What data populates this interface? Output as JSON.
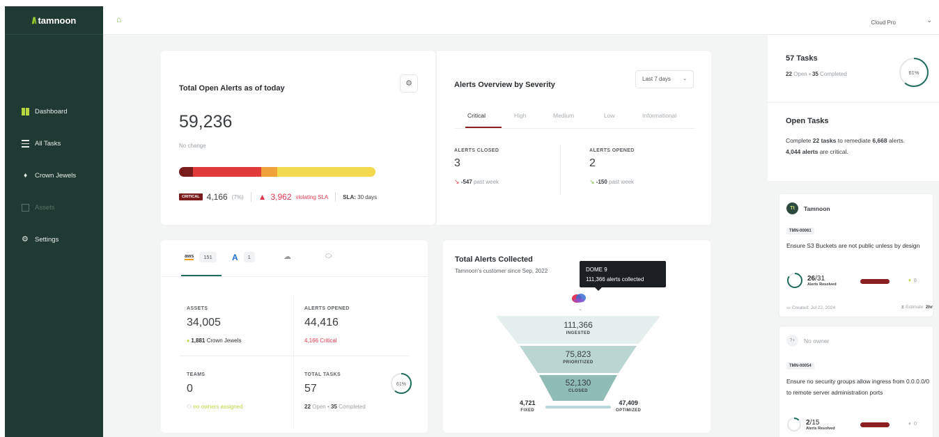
{
  "app": {
    "brand": "tamnoon",
    "account": "Cloud Pro"
  },
  "sidebar": {
    "items": [
      {
        "label": "Dashboard",
        "icon": "dashboard-icon"
      },
      {
        "label": "All Tasks",
        "icon": "list-icon"
      },
      {
        "label": "Crown Jewels",
        "icon": "gem-icon"
      },
      {
        "label": "Assets",
        "icon": "assets-icon",
        "disabled": true
      },
      {
        "label": "Settings",
        "icon": "gear-icon"
      }
    ]
  },
  "open_alerts": {
    "title": "Total Open Alerts as of today",
    "total": "59,236",
    "change": "No change",
    "severity_shares": {
      "critical": 7,
      "high": 35,
      "medium": 8,
      "low": 50
    },
    "critical_badge": "CRITICAL",
    "critical_count": "4,166",
    "critical_pct": "(7%)",
    "sla_violations": "3,962",
    "sla_violating_label": "violating SLA",
    "sla_label": "SLA:",
    "sla_value": "30 days"
  },
  "severity_overview": {
    "title": "Alerts Overview by Severity",
    "range": "Last 7 days",
    "tabs": [
      "Critical",
      "High",
      "Medium",
      "Low",
      "Informational"
    ],
    "active_tab": "Critical",
    "closed_label": "ALERTS CLOSED",
    "closed_value": "3",
    "closed_trend": "-547",
    "opened_label": "ALERTS OPENED",
    "opened_value": "2",
    "opened_trend": "-150",
    "trend_suffix": "past week"
  },
  "cloud_summary": {
    "providers": [
      {
        "name": "aws",
        "count": "151"
      },
      {
        "name": "azure",
        "count": "1"
      },
      {
        "name": "gcp",
        "count": ""
      },
      {
        "name": "oci",
        "count": ""
      }
    ],
    "assets_label": "ASSETS",
    "assets": "34,005",
    "crown_jewels": "1,881",
    "crown_jewels_label": "Crown Jewels",
    "alerts_opened_label": "ALERTS OPENED",
    "alerts_opened": "44,416",
    "alerts_critical": "4,166 Critical",
    "teams_label": "TEAMS",
    "teams": "0",
    "teams_note": "no owners assigned",
    "total_tasks_label": "TOTAL TASKS",
    "total_tasks": "57",
    "open": "22",
    "open_label": "Open",
    "completed": "35",
    "completed_label": "Completed",
    "progress_pct": 61,
    "progress_label": "61%"
  },
  "alerts_collected": {
    "title": "Total Alerts Collected",
    "since": "Tamnoon's customer since Sep, 2022",
    "tooltip_title": "DOME 9",
    "tooltip_text": "111,366 alerts collected",
    "ingested": "111,366",
    "ingested_label": "INGESTED",
    "prioritized": "75,823",
    "prioritized_label": "PRIORITIZED",
    "closed": "52,130",
    "closed_label": "CLOSED",
    "fixed": "4,721",
    "fixed_label": "FIXED",
    "optimized": "47,409",
    "optimized_label": "OPTIMIZED"
  },
  "tasks_panel": {
    "title": "57 Tasks",
    "open": "22",
    "open_label": "Open",
    "completed": "35",
    "completed_label": "Completed",
    "progress_pct": 61,
    "progress_label": "61%",
    "open_tasks_title": "Open Tasks",
    "desc_1": "Complete",
    "desc_tasks": "22 tasks",
    "desc_2": "to remediate",
    "desc_alerts": "6,668",
    "desc_3": "alerts.",
    "desc_critical": "4,044 alerts",
    "desc_4": "are critical.",
    "tasks": [
      {
        "owner": "Tamnoon",
        "owner_initials": "Tt",
        "id": "TMN-00061",
        "name": "Ensure S3 Buckets are not public unless by design",
        "resolved": "26",
        "total": "/31",
        "resolved_label": "Alerts Resolved",
        "progress": 0.84,
        "jewels": "8",
        "created": "Created: Jul 22, 2024",
        "estimate": "Estimate:",
        "estimate_value": "2hr"
      },
      {
        "owner": "No owner",
        "owner_initials": "?+",
        "id": "TMN-00054",
        "name": "Ensure no security groups allow ingress from 0.0.0.0/0 to remote server administration ports",
        "resolved": "2",
        "total": "/15",
        "resolved_label": "Alerts Resolved",
        "progress": 0.13,
        "jewels": "0"
      }
    ]
  }
}
